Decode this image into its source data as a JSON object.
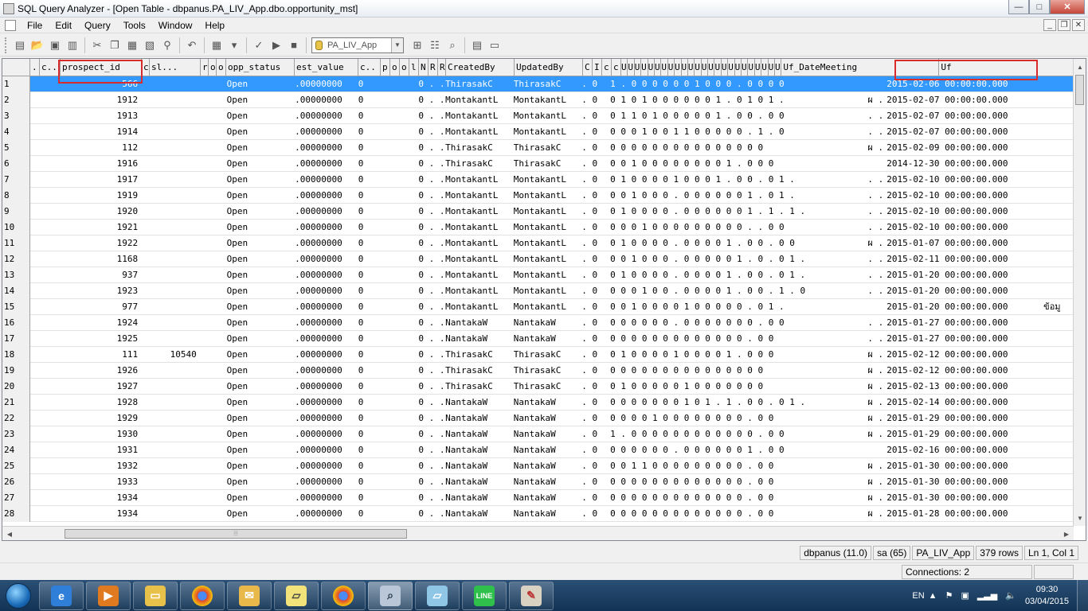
{
  "window": {
    "title": "SQL Query Analyzer - [Open Table - dbpanus.PA_LIV_App.dbo.opportunity_mst]",
    "controls": {
      "minimize": "—",
      "maximize": "□",
      "close": "✕"
    }
  },
  "menu": {
    "items": [
      "File",
      "Edit",
      "Query",
      "Tools",
      "Window",
      "Help"
    ],
    "mdi_controls": {
      "minimize": "_",
      "restore": "❐",
      "close": "✕"
    }
  },
  "toolbar": {
    "database": "PA_LIV_App",
    "icons": [
      "new-query-icon",
      "open-icon",
      "save-icon",
      "cut-icon",
      "copy-icon",
      "paste-icon",
      "find-icon",
      "undo-icon",
      "grid-icon",
      "check-icon",
      "execute-icon",
      "stop-icon",
      "database-icon",
      "object-browser-icon",
      "filter-icon",
      "search-icon",
      "properties-icon",
      "results-icon"
    ]
  },
  "grid": {
    "columns": [
      ".",
      "c..",
      "prospect_id",
      "c",
      "sl...",
      "r",
      "o",
      "o",
      "opp_status",
      "est_value",
      "c..",
      "p",
      "o",
      "o",
      "l",
      "N",
      "R",
      "R",
      "CreatedBy",
      "UpdatedBy",
      "C",
      "I",
      "c",
      "c",
      "U",
      "U",
      "U",
      "U",
      "U",
      "U",
      "U",
      "U",
      "U",
      "U",
      "U",
      "U",
      "U",
      "U",
      "U",
      "U",
      "U",
      "U",
      "U",
      "U",
      "U",
      "U",
      "U",
      "U",
      "Uf_DateMeeting",
      "Uf"
    ],
    "selected_row": 1,
    "rows": [
      {
        "n": "1",
        "pid": "566",
        "sl": "",
        "status": "Open",
        "est": ".00000000",
        "cx": "0",
        "l": "0 . .",
        "cb": "ThirasakC",
        "ub": "ThirasakC",
        "ci": ". 0",
        "u": "1 . 0 0 0 0 0   0 1 0   0   0   . 0   0     0   0",
        "z": "",
        "date": "2015-02-06 00:00:00.000",
        "extra": ""
      },
      {
        "n": "2",
        "pid": "1912",
        "sl": "",
        "status": "Open",
        "est": ".00000000",
        "cx": "0",
        "l": "0 . .",
        "cb": "MontakantL",
        "ub": "MontakantL",
        "ci": ". 0",
        "u": "0   1 0 1 0 0   0 0 0   0   1 .   0   1     0   1 .",
        "z": "ผ .",
        "date": "2015-02-07 00:00:00.000",
        "extra": ""
      },
      {
        "n": "3",
        "pid": "1913",
        "sl": "",
        "status": "Open",
        "est": ".00000000",
        "cx": "0",
        "l": "0 . .",
        "cb": "MontakantL",
        "ub": "MontakantL",
        "ci": ". 0",
        "u": "0   1 1 0 1 0   0 0 0   0   1 .   0   0   . 0   0",
        "z": ". .",
        "date": "2015-02-07 00:00:00.000",
        "extra": ""
      },
      {
        "n": "4",
        "pid": "1914",
        "sl": "",
        "status": "Open",
        "est": ".00000000",
        "cx": "0",
        "l": "0 . .",
        "cb": "MontakantL",
        "ub": "MontakantL",
        "ci": ". 0",
        "u": "0   0 0 1 0 0   1 1 0   0   0     0   0   . 1 . 0",
        "z": ". .",
        "date": "2015-02-07 00:00:00.000",
        "extra": ""
      },
      {
        "n": "5",
        "pid": "112",
        "sl": "",
        "status": "Open",
        "est": ".00000000",
        "cx": "0",
        "l": "0 . .",
        "cb": "ThirasakC",
        "ub": "ThirasakC",
        "ci": ". 0",
        "u": "0   0 0 0 0 0   0 0 0   0   0     0   0     0   0",
        "z": "ผ .",
        "date": "2015-02-09 00:00:00.000",
        "extra": ""
      },
      {
        "n": "6",
        "pid": "1916",
        "sl": "",
        "status": "Open",
        "est": ".00000000",
        "cx": "0",
        "l": "0 . .",
        "cb": "ThirasakC",
        "ub": "ThirasakC",
        "ci": ". 0",
        "u": "0   0 1 0 0 0   0 0 0   0   0     1 . 0     0   0",
        "z": "",
        "date": "2014-12-30 00:00:00.000",
        "extra": ""
      },
      {
        "n": "7",
        "pid": "1917",
        "sl": "",
        "status": "Open",
        "est": ".00000000",
        "cx": "0",
        "l": "0 . .",
        "cb": "MontakantL",
        "ub": "MontakantL",
        "ci": ". 0",
        "u": "0   1 0 0 0 0   1 0 0   0   1 .   0   0   . 0   1 .",
        "z": ". .",
        "date": "2015-02-10 00:00:00.000",
        "extra": ""
      },
      {
        "n": "8",
        "pid": "1919",
        "sl": "",
        "status": "Open",
        "est": ".00000000",
        "cx": "0",
        "l": "0 . .",
        "cb": "MontakantL",
        "ub": "MontakantL",
        "ci": ". 0",
        "u": "0   0 1 0 0 0 . 0 0 0   0   0     0   1   . 0   1 .",
        "z": ". .",
        "date": "2015-02-10 00:00:00.000",
        "extra": ""
      },
      {
        "n": "9",
        "pid": "1920",
        "sl": "",
        "status": "Open",
        "est": ".00000000",
        "cx": "0",
        "l": "0 . .",
        "cb": "MontakantL",
        "ub": "MontakantL",
        "ci": ". 0",
        "u": "0   1 0 0 0 0 . 0 0 0   0   0     0   1   . 1 . 1 .",
        "z": ". .",
        "date": "2015-02-10 00:00:00.000",
        "extra": ""
      },
      {
        "n": "10",
        "pid": "1921",
        "sl": "",
        "status": "Open",
        "est": ".00000000",
        "cx": "0",
        "l": "0 . .",
        "cb": "MontakantL",
        "ub": "MontakantL",
        "ci": ". 0",
        "u": "0   0 0 1 0 0   0 0 0   0   0     0   0 . . 0   0",
        "z": ". .",
        "date": "2015-02-10 00:00:00.000",
        "extra": ""
      },
      {
        "n": "11",
        "pid": "1922",
        "sl": "",
        "status": "Open",
        "est": ".00000000",
        "cx": "0",
        "l": "0 . .",
        "cb": "MontakantL",
        "ub": "MontakantL",
        "ci": ". 0",
        "u": "0   1 0 0 0 0 . 0 0 0   0   1 .   0   0   . 0   0",
        "z": "ผ .",
        "date": "2015-01-07 00:00:00.000",
        "extra": ""
      },
      {
        "n": "12",
        "pid": "1168",
        "sl": "",
        "status": "Open",
        "est": ".00000000",
        "cx": "0",
        "l": "0 . .",
        "cb": "MontakantL",
        "ub": "MontakantL",
        "ci": ". 0",
        "u": "0   0 1 0 0 0 . 0 0 0   0   0     1 . 0   . 0   1 .",
        "z": ". .",
        "date": "2015-02-11 00:00:00.000",
        "extra": ""
      },
      {
        "n": "13",
        "pid": "937",
        "sl": "",
        "status": "Open",
        "est": ".00000000",
        "cx": "0",
        "l": "0 . .",
        "cb": "MontakantL",
        "ub": "MontakantL",
        "ci": ". 0",
        "u": "0   1 0 0 0 0 . 0 0 0   0   1 .   0   0   . 0   1 .",
        "z": ". .",
        "date": "2015-01-20 00:00:00.000",
        "extra": ""
      },
      {
        "n": "14",
        "pid": "1923",
        "sl": "",
        "status": "Open",
        "est": ".00000000",
        "cx": "0",
        "l": "0 . .",
        "cb": "MontakantL",
        "ub": "MontakantL",
        "ci": ". 0",
        "u": "0   0 0 1 0 0 . 0 0 0   0   1 .   0   0   . 1 . 0",
        "z": ". .",
        "date": "2015-01-20 00:00:00.000",
        "extra": ""
      },
      {
        "n": "15",
        "pid": "977",
        "sl": "",
        "status": "Open",
        "est": ".00000000",
        "cx": "0",
        "l": "0 . .",
        "cb": "MontakantL",
        "ub": "MontakantL",
        "ci": ". 0",
        "u": "0   0 1 0 0 0   0 1 0   0   0     0   0   . 0   1 .",
        "z": "",
        "date": "2015-01-20 00:00:00.000",
        "extra": "ข้อมู"
      },
      {
        "n": "16",
        "pid": "1924",
        "sl": "",
        "status": "Open",
        "est": ".00000000",
        "cx": "0",
        "l": "0 . .",
        "cb": "NantakaW",
        "ub": "NantakaW",
        "ci": ". 0",
        "u": "0   0 0 0 0 0 . 0 0 0   0   0     0   0   . 0   0",
        "z": ". .",
        "date": "2015-01-27 00:00:00.000",
        "extra": ""
      },
      {
        "n": "17",
        "pid": "1925",
        "sl": "",
        "status": "Open",
        "est": ".00000000",
        "cx": "0",
        "l": "0 . .",
        "cb": "NantakaW",
        "ub": "NantakaW",
        "ci": ". 0",
        "u": "0   0 0 0 0 0   0 0 0   0   0     0   0   . 0   0",
        "z": ". .",
        "date": "2015-01-27 00:00:00.000",
        "extra": ""
      },
      {
        "n": "18",
        "pid": "111",
        "sl": "10540",
        "status": "Open",
        "est": ".00000000",
        "cx": "0",
        "l": "0 . .",
        "cb": "ThirasakC",
        "ub": "ThirasakC",
        "ci": ". 0",
        "u": "0   1 0 0 0 0   1 0 0   0   0     1 . 0     0   0",
        "z": "ผ .",
        "date": "2015-02-12 00:00:00.000",
        "extra": ""
      },
      {
        "n": "19",
        "pid": "1926",
        "sl": "",
        "status": "Open",
        "est": ".00000000",
        "cx": "0",
        "l": "0 . .",
        "cb": "ThirasakC",
        "ub": "ThirasakC",
        "ci": ". 0",
        "u": "0   0 0 0 0 0   0 0 0   0   0     0   0     0   0",
        "z": "ผ .",
        "date": "2015-02-12 00:00:00.000",
        "extra": ""
      },
      {
        "n": "20",
        "pid": "1927",
        "sl": "",
        "status": "Open",
        "est": ".00000000",
        "cx": "0",
        "l": "0 . .",
        "cb": "ThirasakC",
        "ub": "ThirasakC",
        "ci": ". 0",
        "u": "0   1 0 0 0 0   0 1 0   0   0     0   0     0   0",
        "z": "ผ .",
        "date": "2015-02-13 00:00:00.000",
        "extra": ""
      },
      {
        "n": "21",
        "pid": "1928",
        "sl": "",
        "status": "Open",
        "est": ".00000000",
        "cx": "0",
        "l": "0 . .",
        "cb": "NantakaW",
        "ub": "NantakaW",
        "ci": ". 0",
        "u": "0   0 0 0 0 0   0 1 0   1 . 1 .   0   0   . 0   1 .",
        "z": "ผ .",
        "date": "2015-02-14 00:00:00.000",
        "extra": ""
      },
      {
        "n": "22",
        "pid": "1929",
        "sl": "",
        "status": "Open",
        "est": ".00000000",
        "cx": "0",
        "l": "0 . .",
        "cb": "NantakaW",
        "ub": "NantakaW",
        "ci": ". 0",
        "u": "0   0 0 0 1 0   0 0 0   0   0     0   0   . 0   0",
        "z": "ผ .",
        "date": "2015-01-29 00:00:00.000",
        "extra": ""
      },
      {
        "n": "23",
        "pid": "1930",
        "sl": "",
        "status": "Open",
        "est": ".00000000",
        "cx": "0",
        "l": "0 . .",
        "cb": "NantakaW",
        "ub": "NantakaW",
        "ci": ". 0",
        "u": "1 . 0 0 0 0 0   0 0 0   0   0     0   0   . 0   0",
        "z": "ผ .",
        "date": "2015-01-29 00:00:00.000",
        "extra": ""
      },
      {
        "n": "24",
        "pid": "1931",
        "sl": "",
        "status": "Open",
        "est": ".00000000",
        "cx": "0",
        "l": "0 . .",
        "cb": "NantakaW",
        "ub": "NantakaW",
        "ci": ". 0",
        "u": "0   0 0 0 0 0 . 0 0 0   0   0     0   1   . 0   0",
        "z": "",
        "date": "2015-02-16 00:00:00.000",
        "extra": ""
      },
      {
        "n": "25",
        "pid": "1932",
        "sl": "",
        "status": "Open",
        "est": ".00000000",
        "cx": "0",
        "l": "0 . .",
        "cb": "NantakaW",
        "ub": "NantakaW",
        "ci": ". 0",
        "u": "0   0 1 1 0 0   0 0 0   0   0     0   0   . 0   0",
        "z": "ผ .",
        "date": "2015-01-30 00:00:00.000",
        "extra": ""
      },
      {
        "n": "26",
        "pid": "1933",
        "sl": "",
        "status": "Open",
        "est": ".00000000",
        "cx": "0",
        "l": "0 . .",
        "cb": "NantakaW",
        "ub": "NantakaW",
        "ci": ". 0",
        "u": "0   0 0 0 0 0   0 0 0   0   0     0   0   . 0   0",
        "z": "ผ .",
        "date": "2015-01-30 00:00:00.000",
        "extra": ""
      },
      {
        "n": "27",
        "pid": "1934",
        "sl": "",
        "status": "Open",
        "est": ".00000000",
        "cx": "0",
        "l": "0 . .",
        "cb": "NantakaW",
        "ub": "NantakaW",
        "ci": ". 0",
        "u": "0   0 0 0 0 0   0 0 0   0   0     0   0   . 0   0",
        "z": "ผ .",
        "date": "2015-01-30 00:00:00.000",
        "extra": ""
      },
      {
        "n": "28",
        "pid": "1934",
        "sl": "",
        "status": "Open",
        "est": ".00000000",
        "cx": "0",
        "l": "0 . .",
        "cb": "NantakaW",
        "ub": "NantakaW",
        "ci": ". 0",
        "u": "0   0 0 0 0 0   0 0 0   0   0     0   0   . 0   0",
        "z": "ผ .",
        "date": "2015-01-28 00:00:00.000",
        "extra": ""
      }
    ]
  },
  "statusbar": {
    "server": "dbpanus (11.0)",
    "user": "sa (65)",
    "database": "PA_LIV_App",
    "rows": "379 rows",
    "position": "Ln 1, Col 1",
    "connections": "Connections: 2"
  },
  "taskbar": {
    "apps": [
      "ie-icon",
      "media-player-icon",
      "explorer-icon",
      "chrome-icon",
      "outlook-icon",
      "sticky-notes-icon",
      "chrome-icon",
      "query-analyzer-icon",
      "notepad-icon",
      "line-icon",
      "paint-icon"
    ],
    "line_label": "LINE",
    "lang": "EN",
    "time": "09:30",
    "date": "03/04/2015"
  },
  "colors": {
    "selection": "#3399ff",
    "highlight_box": "#d92b2b",
    "taskbar": "#1b3d60"
  }
}
